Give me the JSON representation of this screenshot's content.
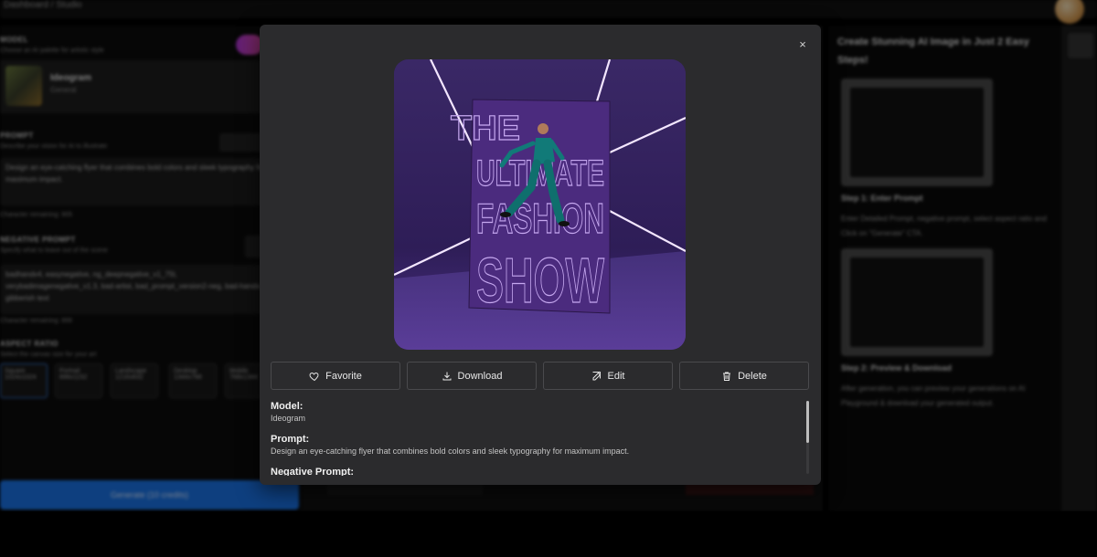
{
  "app": {
    "breadcrumb": "Dashboard / Studio"
  },
  "left_panel": {
    "model_section": {
      "title": "MODEL",
      "subtitle": "Choose an AI palette for artistic style",
      "model_name": "Ideogram",
      "model_sub": "General"
    },
    "prompt_section": {
      "title": "PROMPT",
      "subtitle": "Describe your vision for AI to illustrate",
      "value": "Design an eye-catching flyer that combines bold colors and sleek typography for maximum impact.",
      "chars_remaining": "Character remaining: 905"
    },
    "negative_section": {
      "title": "NEGATIVE PROMPT",
      "subtitle": "Specify what to leave out of the scene",
      "value": "badhandv4, easynegative, ng_deepnegative_v1_75t, verybadimagenegative_v1.3, bad-artist, bad_prompt_version2-neg, bad-hands-5, gibberish text",
      "chars_remaining": "Character remaining: 866"
    },
    "aspect_section": {
      "title": "ASPECT RATIO",
      "subtitle": "Select the canvas size for your art",
      "options": [
        {
          "label": "Square",
          "sub": "1024x1024"
        },
        {
          "label": "Portrait",
          "sub": "896x1152"
        },
        {
          "label": "Landscape",
          "sub": "1216x832"
        },
        {
          "label": "Desktop",
          "sub": "1344x768"
        },
        {
          "label": "Mobile",
          "sub": "768x1344"
        }
      ]
    },
    "generate_label": "Generate (10 credits)"
  },
  "right_panel": {
    "title": "Create Stunning AI Image in Just 2 Easy Steps!",
    "step1_title": "Step 1: Enter Prompt",
    "step1_desc": "Enter Detailed Prompt, negative prompt, select aspect ratio and Click on \"Generate\" CTA.",
    "step2_title": "Step 2: Preview & Download",
    "step2_desc": "After generation, you can preview your generations on AI Playground & download your generated output."
  },
  "modal": {
    "close_glyph": "×",
    "poster_text": {
      "line1": "THE",
      "line2": "ULTIMATE",
      "line3": "FASHION",
      "line4": "SHOW"
    },
    "actions": {
      "favorite": "Favorite",
      "download": "Download",
      "edit": "Edit",
      "delete": "Delete"
    },
    "details": {
      "model_label": "Model:",
      "model_value": "Ideogram",
      "prompt_label": "Prompt:",
      "prompt_value": "Design an eye-catching flyer that combines bold colors and sleek typography for maximum impact.",
      "negative_label": "Negative Prompt:"
    }
  },
  "colors": {
    "accent": "#1a74e8",
    "modal_bg": "#2b2b2d",
    "poster_purple": "#35205e"
  },
  "icons": {
    "favorite": "heart-icon",
    "download": "download-icon",
    "edit": "edit-icon",
    "delete": "trash-icon",
    "close": "close-icon"
  }
}
